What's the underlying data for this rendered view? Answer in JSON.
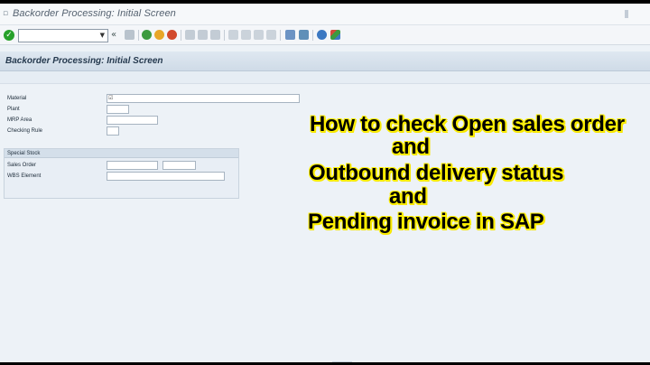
{
  "window": {
    "title": "Backorder Processing: Initial Screen"
  },
  "toolbar": {
    "command_value": "",
    "icons": [
      "enter-icon",
      "save-icon",
      "back-icon",
      "exit-icon",
      "cancel-icon",
      "print-icon",
      "find-icon",
      "find-next-icon",
      "first-page-icon",
      "previous-page-icon",
      "next-page-icon",
      "last-page-icon",
      "create-session-icon",
      "shortcut-icon",
      "help-icon",
      "customize-layout-icon"
    ]
  },
  "screen": {
    "title": "Backorder Processing: Initial Screen"
  },
  "form": {
    "material_label": "Material",
    "plant_label": "Plant",
    "mrp_area_label": "MRP Area",
    "checking_rule_label": "Checking Rule",
    "special_stock_title": "Special Stock",
    "sales_order_label": "Sales Order",
    "wbs_element_label": "WBS Element",
    "material_value": "",
    "plant_value": "",
    "mrp_area_value": "",
    "checking_rule_value": "",
    "sales_order_value": "",
    "sales_order_item_value": "",
    "wbs_element_value": ""
  },
  "overlay": {
    "line1": "How to check Open sales order",
    "line2": "and",
    "line3": "Outbound delivery status",
    "line4": "and",
    "line5": "Pending invoice in SAP"
  },
  "colors": {
    "overlay_text": "#000000",
    "overlay_outline": "#fff200",
    "ok_green": "#27a12b",
    "background": "#edf2f7"
  }
}
